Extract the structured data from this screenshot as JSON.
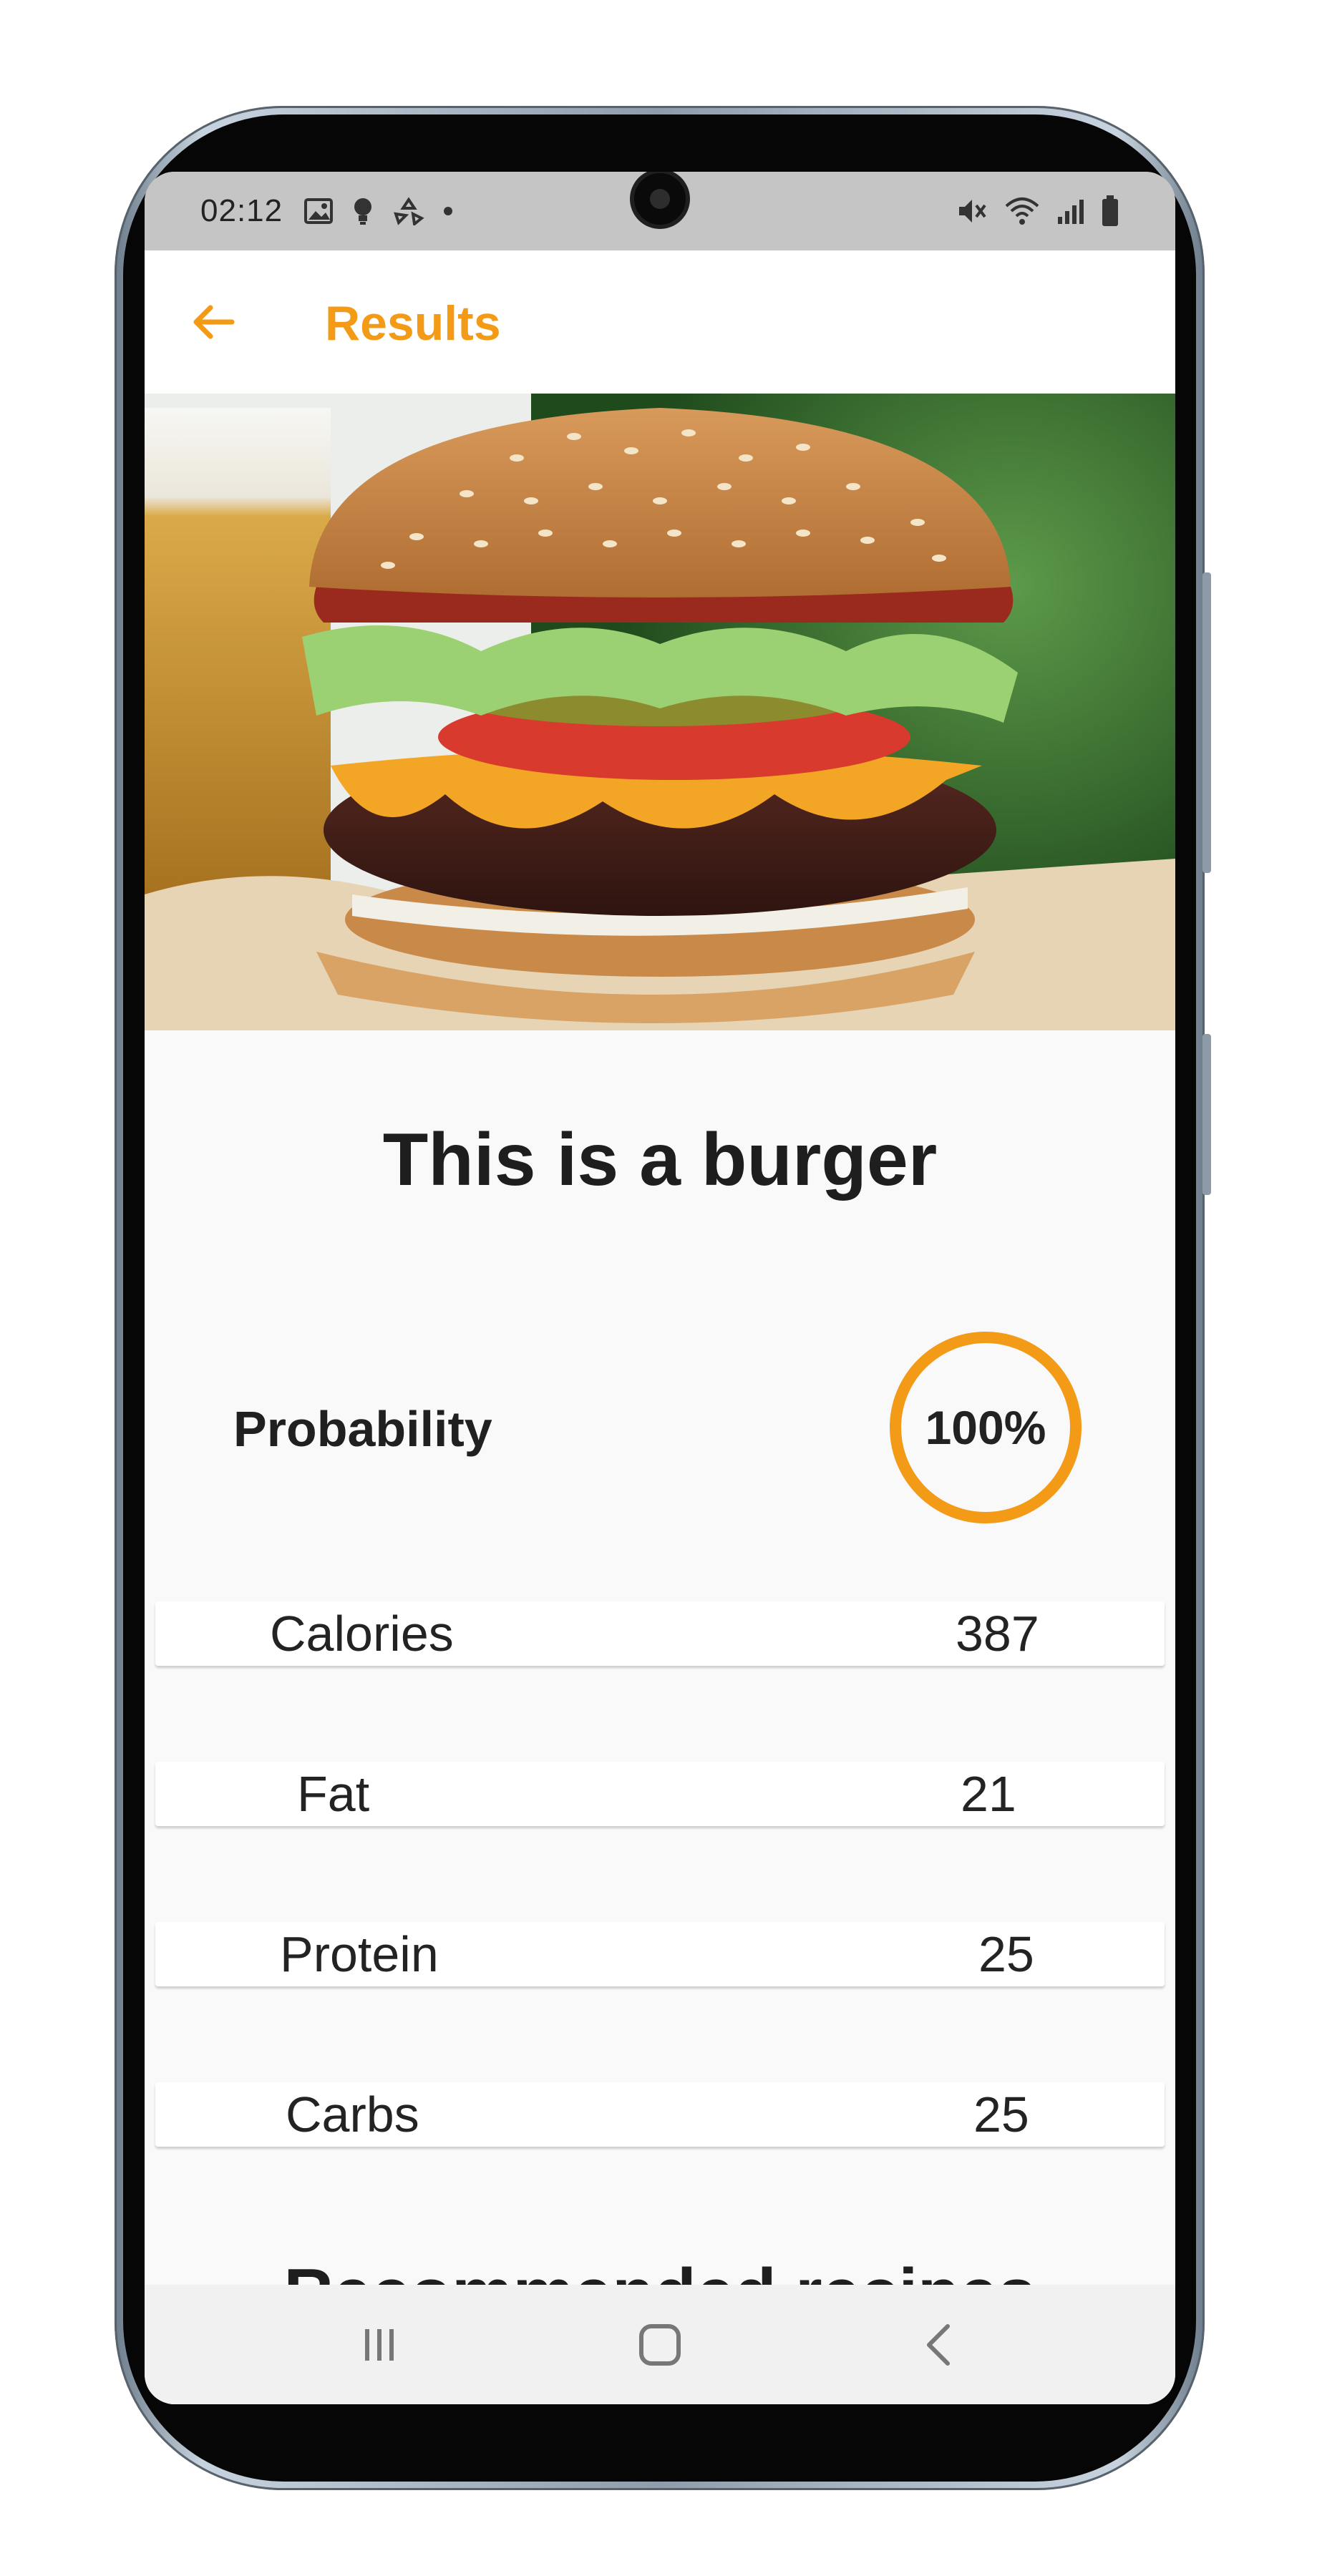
{
  "status_bar": {
    "time": "02:12",
    "left_icons": [
      "image-icon",
      "lightbulb-icon",
      "recycle-icon",
      "dot-icon"
    ],
    "right_icons": [
      "mute-icon",
      "wifi-icon",
      "signal-icon",
      "battery-icon"
    ]
  },
  "app_bar": {
    "title": "Results",
    "back_icon": "arrow-left-icon",
    "accent_color": "#f39a16"
  },
  "result": {
    "headline": "This is a burger",
    "probability_label": "Probability",
    "probability_value": "100%",
    "probability_fraction": 1.0
  },
  "nutrition": [
    {
      "label": "Calories",
      "value": "387"
    },
    {
      "label": "Fat",
      "value": "21"
    },
    {
      "label": "Protein",
      "value": "25"
    },
    {
      "label": "Carbs",
      "value": "25"
    }
  ],
  "recipes_heading": "Recommended recipes",
  "nav_bar": {
    "icons": [
      "recents-icon",
      "home-icon",
      "back-icon"
    ]
  }
}
